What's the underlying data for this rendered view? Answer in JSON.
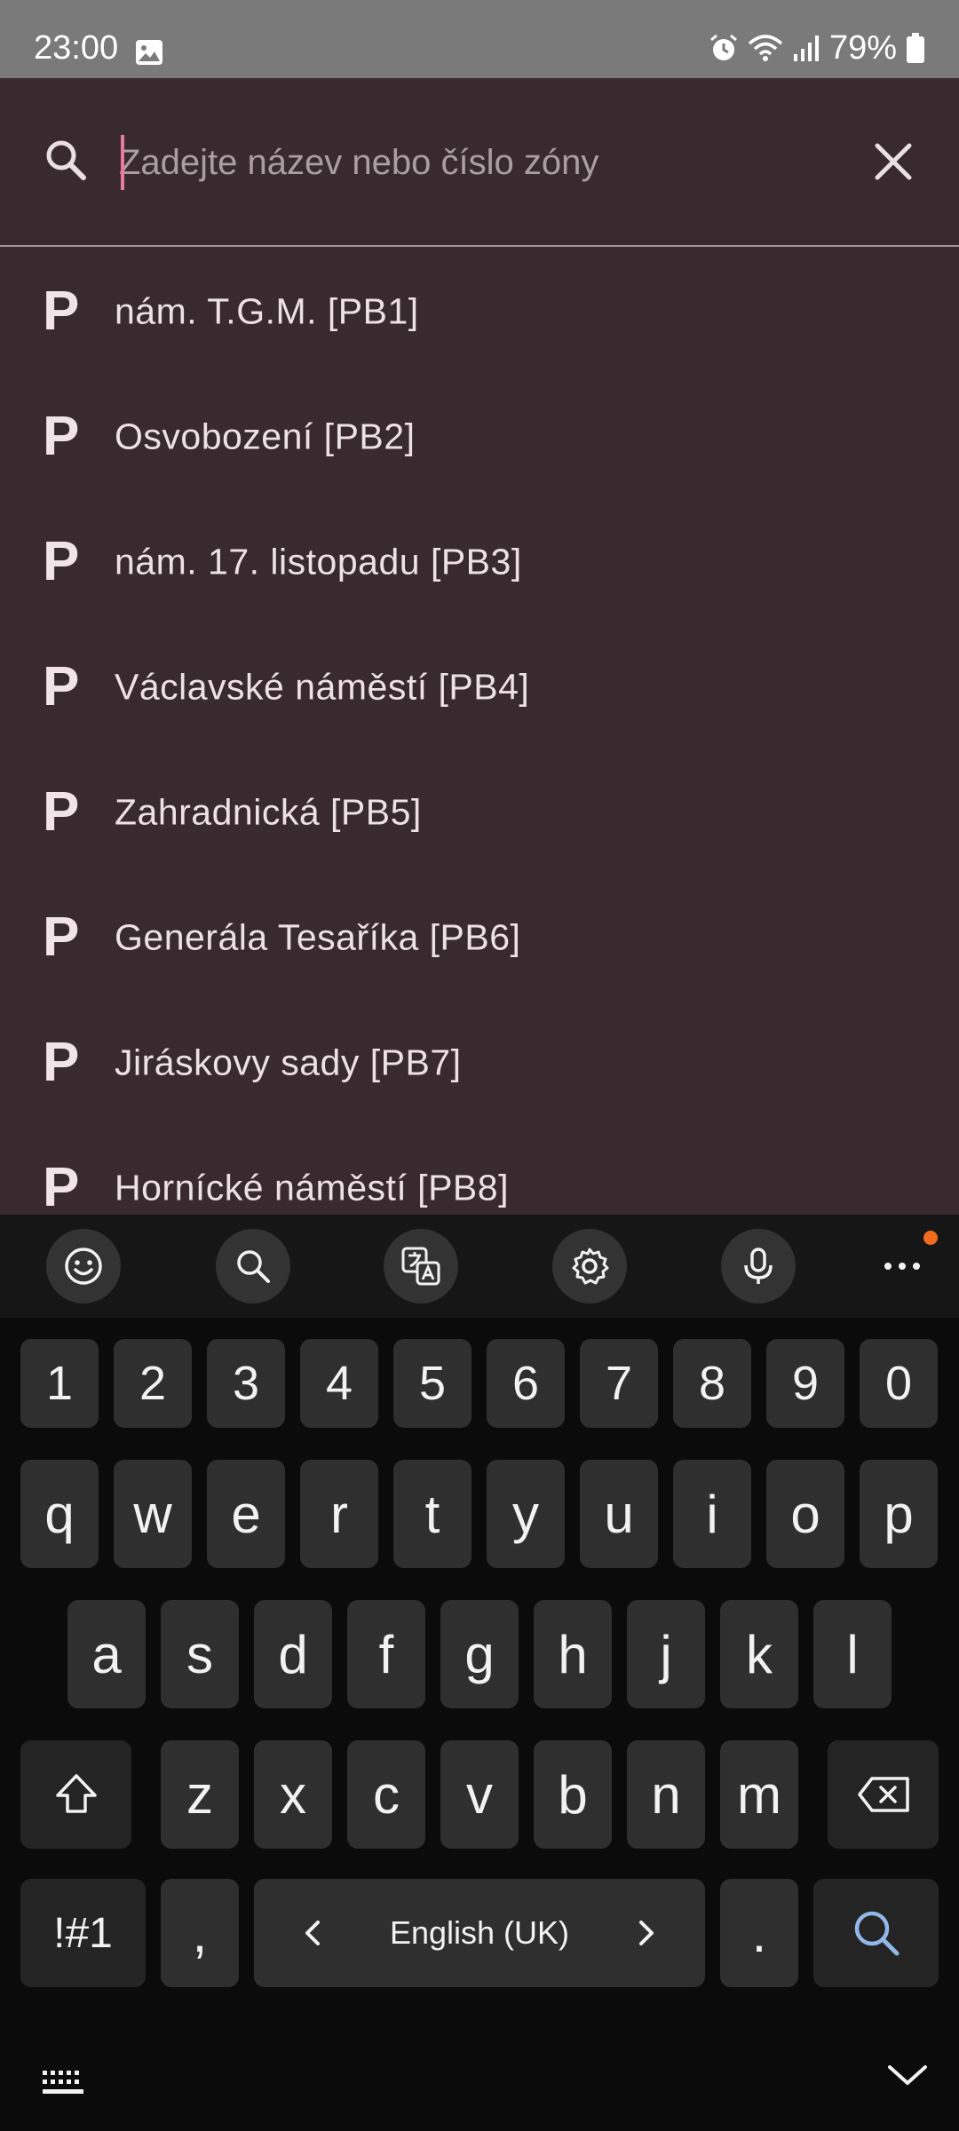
{
  "status_bar": {
    "time": "23:00",
    "battery": "79%",
    "icons": [
      "image-icon",
      "alarm-icon",
      "wifi-icon",
      "signal-icon",
      "battery-icon"
    ]
  },
  "search": {
    "placeholder": "Zadejte název nebo číslo zóny",
    "value": "",
    "icons": [
      "search-icon",
      "close-icon"
    ]
  },
  "zones": [
    {
      "icon": "P",
      "label": "nám. T.G.M. [PB1]"
    },
    {
      "icon": "P",
      "label": "Osvobození [PB2]"
    },
    {
      "icon": "P",
      "label": "nám. 17. listopadu [PB3]"
    },
    {
      "icon": "P",
      "label": "Václavské náměstí [PB4]"
    },
    {
      "icon": "P",
      "label": "Zahradnická [PB5]"
    },
    {
      "icon": "P",
      "label": "Generála Tesaříka [PB6]"
    },
    {
      "icon": "P",
      "label": "Jiráskovy sady [PB7]"
    },
    {
      "icon": "P",
      "label": "Hornícké náměstí [PB8]"
    }
  ],
  "keyboard": {
    "toolbar": [
      "emoji-icon",
      "search-icon",
      "translate-icon",
      "settings-icon",
      "microphone-icon",
      "more-icon"
    ],
    "number_row": [
      "1",
      "2",
      "3",
      "4",
      "5",
      "6",
      "7",
      "8",
      "9",
      "0"
    ],
    "row1": [
      "q",
      "w",
      "e",
      "r",
      "t",
      "y",
      "u",
      "i",
      "o",
      "p"
    ],
    "row2": [
      "a",
      "s",
      "d",
      "f",
      "g",
      "h",
      "j",
      "k",
      "l"
    ],
    "row3": [
      "z",
      "x",
      "c",
      "v",
      "b",
      "n",
      "m"
    ],
    "symbols_label": "!#1",
    "comma": ",",
    "language": "English (UK)",
    "period": ".",
    "action_icon": "search-icon"
  },
  "colors": {
    "app_background": "#382a2f",
    "status_bar": "#7a7a7a",
    "caret": "#e77aa0",
    "keyboard_background": "#0b0b0b",
    "key": "#2f2f2f",
    "search_action": "#8fb7e8",
    "notification_dot": "#f46a1e"
  }
}
